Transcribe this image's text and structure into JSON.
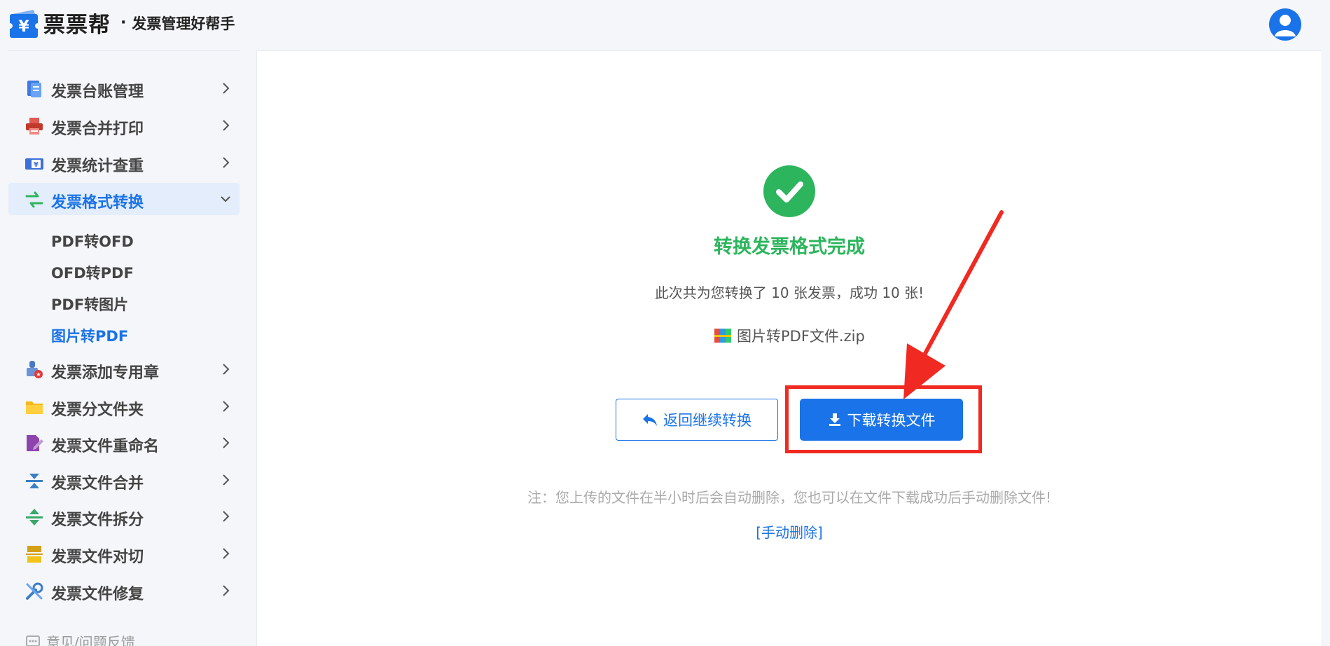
{
  "header": {
    "logo_text": "票票帮",
    "logo_dot": "·",
    "slogan": "发票管理好帮手",
    "logo_icon": "yen-ticket-icon",
    "avatar_icon": "user-avatar-icon"
  },
  "sidebar": {
    "items": [
      {
        "label": "发票台账管理",
        "icon": "ledger-icon"
      },
      {
        "label": "发票合并打印",
        "icon": "printer-icon"
      },
      {
        "label": "发票统计查重",
        "icon": "stats-icon"
      },
      {
        "label": "发票格式转换",
        "icon": "convert-icon",
        "active": true
      },
      {
        "label": "发票添加专用章",
        "icon": "stamp-icon"
      },
      {
        "label": "发票分文件夹",
        "icon": "folder-icon"
      },
      {
        "label": "发票文件重命名",
        "icon": "rename-icon"
      },
      {
        "label": "发票文件合并",
        "icon": "merge-icon"
      },
      {
        "label": "发票文件拆分",
        "icon": "split-icon"
      },
      {
        "label": "发票文件对切",
        "icon": "cut-icon"
      },
      {
        "label": "发票文件修复",
        "icon": "repair-icon"
      }
    ],
    "subitems": [
      {
        "label": "PDF转OFD"
      },
      {
        "label": "OFD转PDF"
      },
      {
        "label": "PDF转图片"
      },
      {
        "label": "图片转PDF",
        "active": true
      }
    ],
    "feedback": "意见/问题反馈"
  },
  "main": {
    "title": "转换发票格式完成",
    "summary": "此次共为您转换了 10 张发票，成功 10 张!",
    "file_name": "图片转PDF文件.zip",
    "back_label": "返回继续转换",
    "download_label": "下载转换文件",
    "note": "注：您上传的文件在半小时后会自动删除，您也可以在文件下载成功后手动删除文件!",
    "delete_label": "[手动删除]"
  },
  "colors": {
    "accent": "#1a73e8",
    "success": "#2db55d",
    "annotation_red": "#f02a22"
  }
}
